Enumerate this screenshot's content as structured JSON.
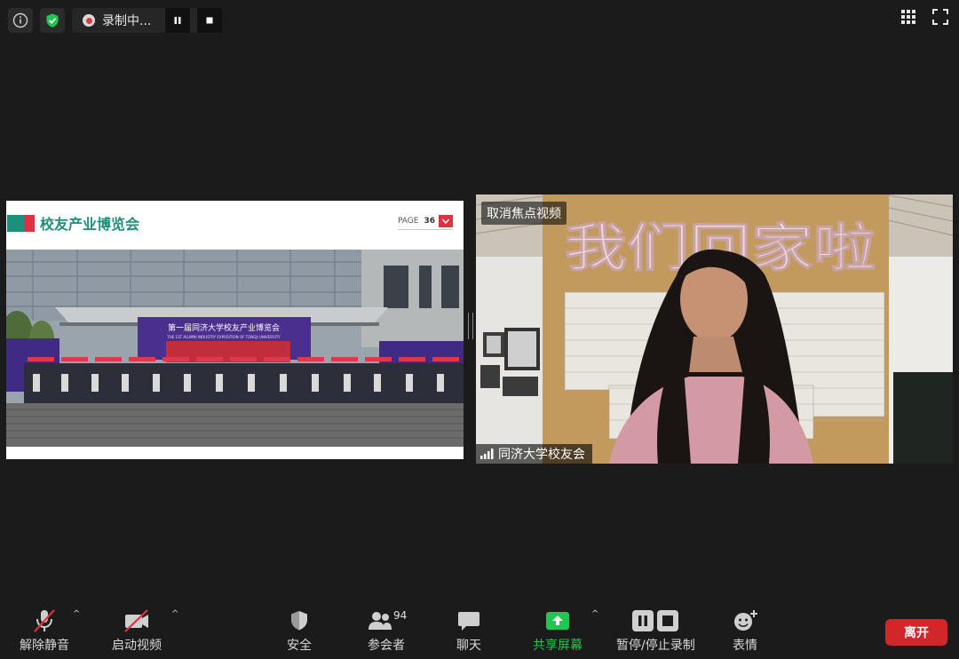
{
  "top_bar": {
    "recording_text": "录制中..."
  },
  "share": {
    "slide_title": "校友产业博览会",
    "page_label": "PAGE",
    "page_number": "36",
    "banner_text": "第一届同济大学校友产业博览会",
    "banner_subtext": "THE 1ST ALUMNI INDUSTRY EXPOSITION OF TONGJI UNIVERSITY"
  },
  "video": {
    "unfocus_label": "取消焦点视频",
    "participant_name": "同济大学校友会",
    "wall_text": "我们回家啦"
  },
  "toolbar": {
    "mute_label": "解除静音",
    "video_label": "启动视频",
    "security_label": "安全",
    "participants_label": "参会者",
    "participants_count": "94",
    "chat_label": "聊天",
    "share_label": "共享屏幕",
    "record_label": "暂停/停止录制",
    "reactions_label": "表情",
    "leave_label": "离开"
  },
  "colors": {
    "background": "#1b1b1b",
    "share_green": "#23c552",
    "leave_red": "#d3262b",
    "title_teal": "#1d8f7b",
    "accent_red": "#e03141"
  }
}
